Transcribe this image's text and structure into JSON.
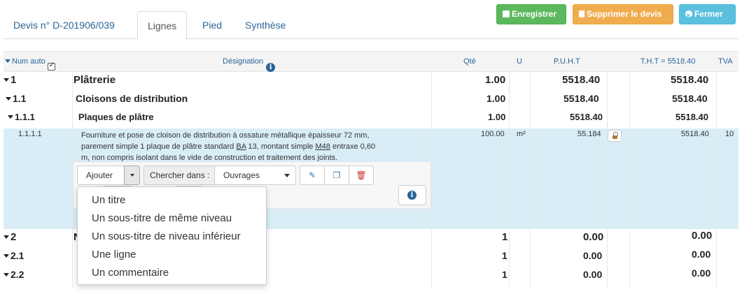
{
  "tabs": [
    {
      "label": "Devis n° D-201906/039"
    },
    {
      "label": "Lignes"
    },
    {
      "label": "Pied"
    },
    {
      "label": "Synthèse"
    }
  ],
  "buttons": {
    "save": "Enregistrer",
    "delete": "Supprimer le devis",
    "close": "Fermer"
  },
  "table": {
    "headers": {
      "num": "Num auto",
      "designation": "Désignation",
      "qty": "Qté",
      "unit": "U",
      "puht": "P.U.H.T",
      "tht": "T.H.T = 5518.40",
      "tva": "TVA"
    },
    "rows": [
      {
        "num": "1",
        "label": "Plâtrerie",
        "qty": "1.00",
        "puht": "5518.40",
        "tht": "5518.40"
      },
      {
        "num": "1.1",
        "label": "Cloisons de distribution",
        "qty": "1.00",
        "puht": "5518.40",
        "tht": "5518.40"
      },
      {
        "num": "1.1.1",
        "label": "Plaques de plâtre",
        "qty": "1.00",
        "puht": "5518.40",
        "tht": "5518.40"
      },
      {
        "num": "1.1.1.1",
        "desc_line1": "Fourniture et pose de cloison de distribution à ossature métallique épaisseur 72 mm,",
        "desc_line2_a": "parement simple 1 plaque de plâtre standard ",
        "desc_line2_b": "BA",
        "desc_line2_c": " 13, montant simple ",
        "desc_line2_d": "M48",
        "desc_line2_e": " entraxe 0,60",
        "desc_line3": "m, non compris isolant dans le vide de construction et traitement des joints.",
        "qty": "100.00",
        "unit": "m²",
        "puht": "55.184",
        "tht": "5518.40",
        "tva": "10"
      },
      {
        "num": "2",
        "label_partial": "N",
        "qty": "1",
        "puht": "0.00",
        "tht": "0.00"
      },
      {
        "num": "2.1",
        "qty": "1",
        "puht": "0.00",
        "tht": "0.00"
      },
      {
        "num": "2.2",
        "qty": "1",
        "puht": "0.00",
        "tht": "0.00"
      }
    ]
  },
  "toolbar": {
    "add": "Ajouter",
    "search_label": "Chercher dans :",
    "search_value": "Ouvrages"
  },
  "dropdown": {
    "items": [
      "Un titre",
      "Un sous-titre de même niveau",
      "Un sous-titre de niveau inférieur",
      "Une ligne",
      "Un commentaire"
    ]
  },
  "colors": {
    "save": "#5cb85c",
    "delete": "#f0ad4e",
    "close": "#5bc0de",
    "highlight_row": "#d9edf7",
    "link": "#2a6496"
  }
}
